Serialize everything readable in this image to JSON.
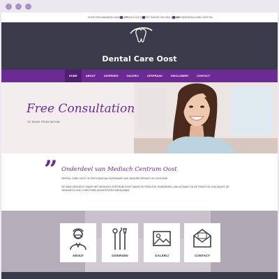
{
  "topbar": {
    "appointment": "KOOP EEN MAANDPLANSING OP",
    "phone": "(075) 619 015 02 57",
    "hours": "OP DAGOE OM SDN 4 UANG",
    "email": "INFO@DENTALCARE-OOST.NL"
  },
  "header": {
    "logo_text": "Dental Care Oost"
  },
  "nav": {
    "items": [
      "HOME",
      "ABOUT",
      "DIVERSEN",
      "GALERIJ",
      "AFSPRAAK",
      "DISCLAIMER",
      "CONTACT"
    ],
    "active": "HOME"
  },
  "hero": {
    "title": "Free Consultation",
    "subtitle": "TO SMILE FROM WITHIN"
  },
  "about": {
    "title": "Onderdeel van Medisch Centrum Oost",
    "line1": "DENTAL CARE OOST IS ONTSTAAN NA OVERNAME VAN TANDARTSPRAKTIJK SCHOONE.",
    "line2": "DE MAW VERHUIST MAAR HET MEDISCH CENTRUM OOST MAAR DE PRAKTIJK ONDERDEEL VAN UITMAKT IN DE PRAKTIJK ZIJN NAAST DE TANDARTS OOK 2 PARTTIME ASSISTENTES WERKZAAM."
  },
  "services": {
    "cards": [
      {
        "label": "ABOUT",
        "icon": "dentist-icon"
      },
      {
        "label": "DIVERSEN",
        "icon": "dental-tools-icon"
      },
      {
        "label": "GALERIJ",
        "icon": "gallery-icon"
      },
      {
        "label": "CONTACT",
        "icon": "envelope-icon"
      }
    ]
  },
  "colors": {
    "accent": "#6a2c93",
    "header_dark": "#3b3a4a",
    "chrome": "#ece8f0"
  }
}
